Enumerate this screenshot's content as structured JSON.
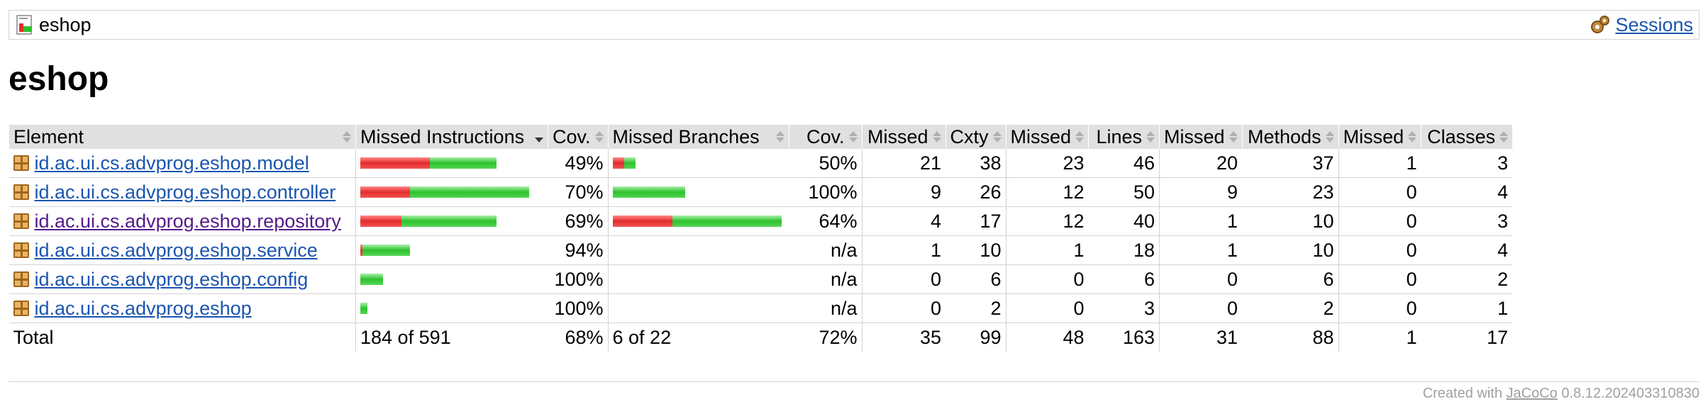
{
  "breadcrumb": {
    "title": "eshop",
    "icon": "report-icon",
    "sessions_label": "Sessions",
    "sessions_icon": "session-icon"
  },
  "page_title": "eshop",
  "table": {
    "headers": {
      "element": "Element",
      "missed_instructions": "Missed Instructions",
      "cov1": "Cov.",
      "missed_branches": "Missed Branches",
      "cov2": "Cov.",
      "missed_cxty": "Missed",
      "cxty": "Cxty",
      "missed_lines": "Missed",
      "lines": "Lines",
      "missed_methods": "Missed",
      "methods": "Methods",
      "missed_classes": "Missed",
      "classes": "Classes"
    },
    "rows": [
      {
        "name": "id.ac.ui.cs.advprog.eshop.model",
        "instr_cov": "49%",
        "branch_cov": "50%",
        "missed_cxty": "21",
        "cxty": "38",
        "missed_lines": "23",
        "lines": "46",
        "missed_methods": "20",
        "methods": "37",
        "missed_classes": "1",
        "classes": "3"
      },
      {
        "name": "id.ac.ui.cs.advprog.eshop.controller",
        "instr_cov": "70%",
        "branch_cov": "100%",
        "missed_cxty": "9",
        "cxty": "26",
        "missed_lines": "12",
        "lines": "50",
        "missed_methods": "9",
        "methods": "23",
        "missed_classes": "0",
        "classes": "4"
      },
      {
        "name": "id.ac.ui.cs.advprog.eshop.repository",
        "instr_cov": "69%",
        "branch_cov": "64%",
        "missed_cxty": "4",
        "cxty": "17",
        "missed_lines": "12",
        "lines": "40",
        "missed_methods": "1",
        "methods": "10",
        "missed_classes": "0",
        "classes": "3"
      },
      {
        "name": "id.ac.ui.cs.advprog.eshop.service",
        "instr_cov": "94%",
        "branch_cov": "n/a",
        "missed_cxty": "1",
        "cxty": "10",
        "missed_lines": "1",
        "lines": "18",
        "missed_methods": "1",
        "methods": "10",
        "missed_classes": "0",
        "classes": "4"
      },
      {
        "name": "id.ac.ui.cs.advprog.eshop.config",
        "instr_cov": "100%",
        "branch_cov": "n/a",
        "missed_cxty": "0",
        "cxty": "6",
        "missed_lines": "0",
        "lines": "6",
        "missed_methods": "0",
        "methods": "6",
        "missed_classes": "0",
        "classes": "2"
      },
      {
        "name": "id.ac.ui.cs.advprog.eshop",
        "instr_cov": "100%",
        "branch_cov": "n/a",
        "missed_cxty": "0",
        "cxty": "2",
        "missed_lines": "0",
        "lines": "3",
        "missed_methods": "0",
        "methods": "2",
        "missed_classes": "0",
        "classes": "1"
      }
    ],
    "total": {
      "label": "Total",
      "instr": "184 of 591",
      "instr_cov": "68%",
      "branch": "6 of 22",
      "branch_cov": "72%",
      "missed_cxty": "35",
      "cxty": "99",
      "missed_lines": "48",
      "lines": "163",
      "missed_methods": "31",
      "methods": "88",
      "missed_classes": "1",
      "classes": "17"
    }
  },
  "footer": {
    "prefix": "Created with",
    "link": "JaCoCo",
    "version": "0.8.12.202403310830"
  },
  "colors": {
    "missed": "#e32b2b",
    "covered": "#2cc22c"
  }
}
